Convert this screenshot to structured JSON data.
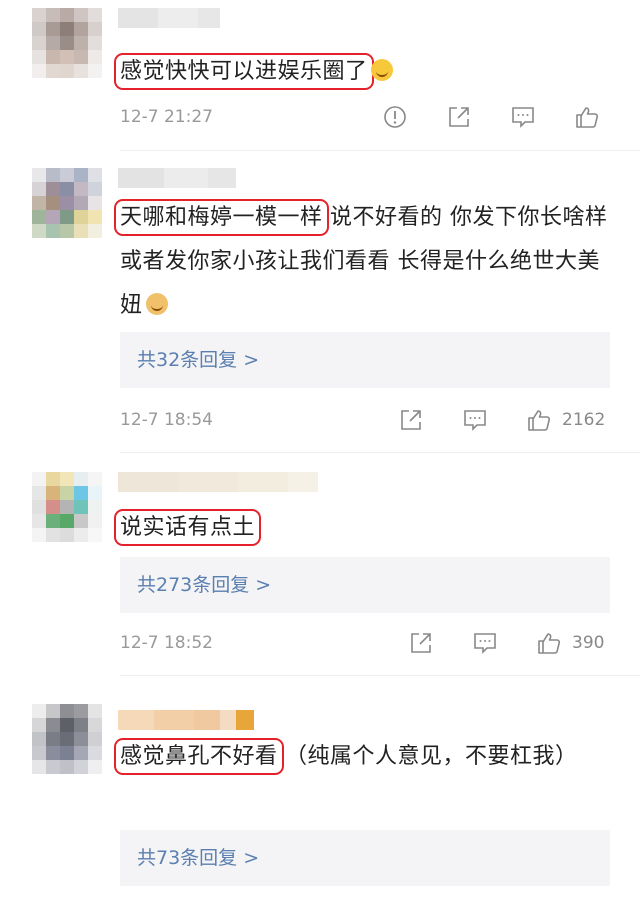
{
  "colors": {
    "highlight": "#e5222b",
    "reply_link": "#5a7fb0",
    "meta": "#999999"
  },
  "comments": [
    {
      "highlight": "感觉快快可以进娱乐圈了",
      "rest": "",
      "emoji": "grin-emoji",
      "time": "12-7 21:27",
      "icons": [
        "report-icon",
        "share-icon",
        "comment-icon",
        "like-icon"
      ]
    },
    {
      "highlight": "天哪和梅婷一模一样",
      "rest": "说不好看的 你发下你长啥样或者发你家小孩让我们看看 长得是什么绝世大美妞",
      "emoji": "doge-emoji",
      "reply_count": "共32条回复 >",
      "time": "12-7 18:54",
      "likes": "2162"
    },
    {
      "highlight": "说实话有点土",
      "rest": "",
      "reply_count": "共273条回复 >",
      "time": "12-7 18:52",
      "likes": "390"
    },
    {
      "highlight": "感觉鼻孔不好看",
      "rest": "（纯属个人意见，不要杠我）",
      "reply_count": "共73条回复 >"
    }
  ]
}
